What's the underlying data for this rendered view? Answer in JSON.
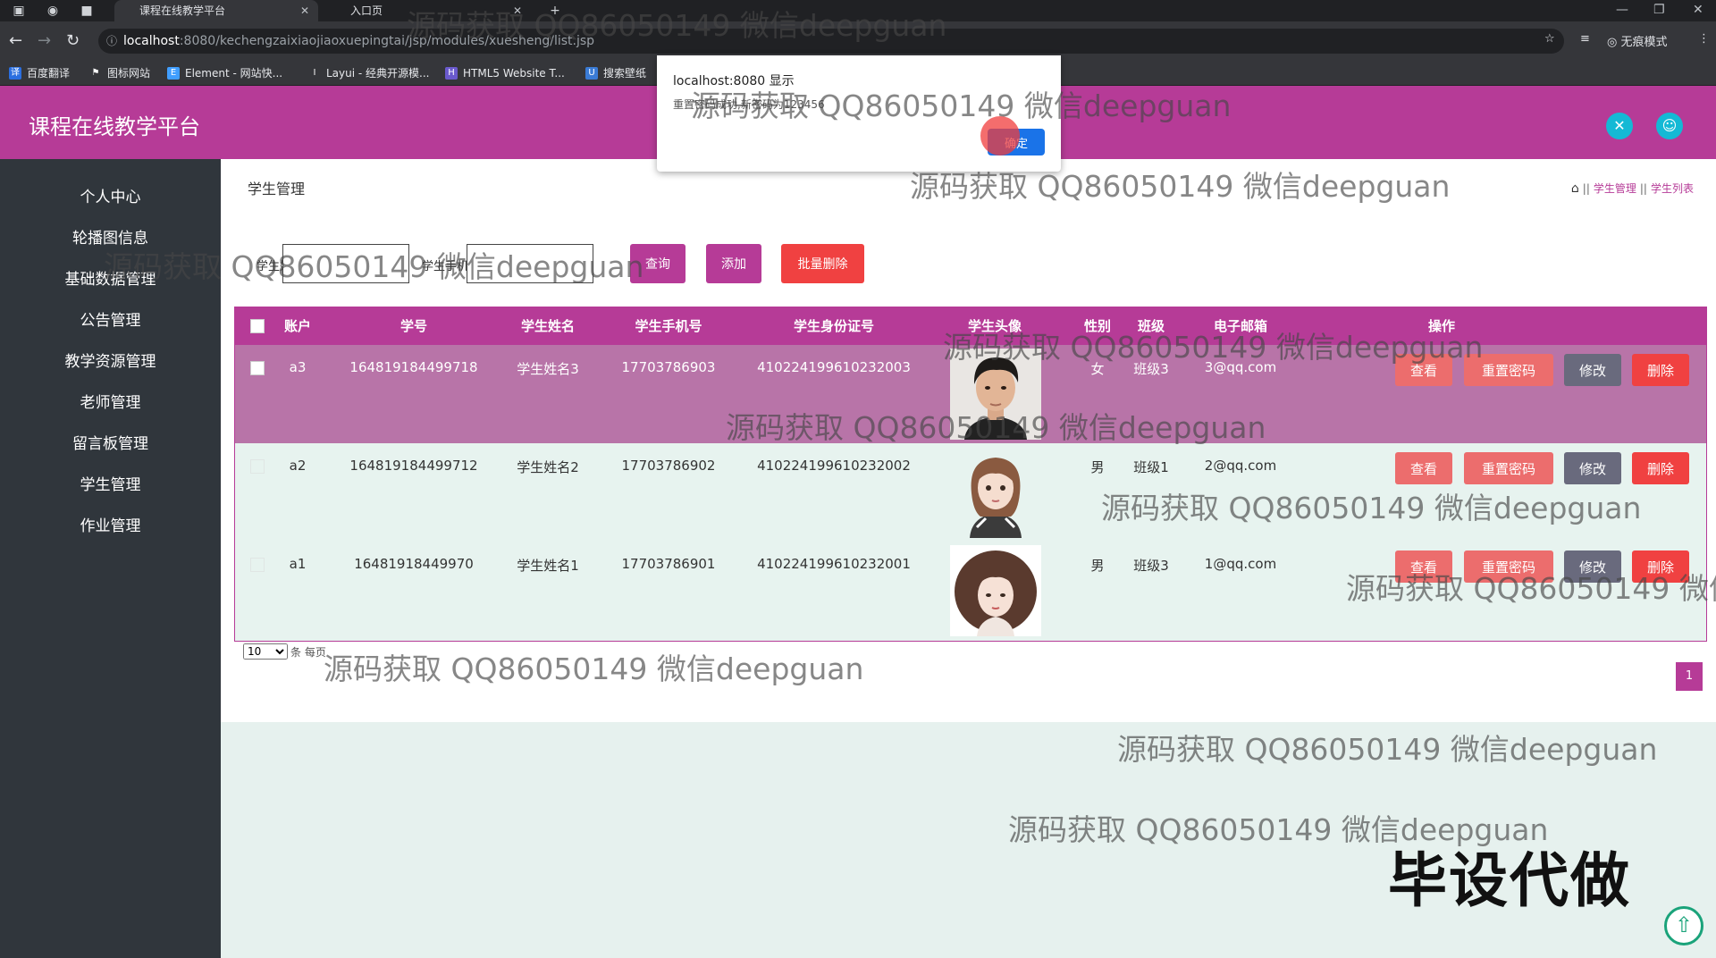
{
  "browser": {
    "tabs": [
      {
        "label": "课程在线教学平台",
        "active": true
      },
      {
        "label": "入口页",
        "active": false
      }
    ],
    "url_host": "localhost",
    "url_path": ":8080/kechengzaixiaojiaoxuepingtai/jsp/modules/xuesheng/list.jsp",
    "profile_label": "无痕模式",
    "bookmarks": [
      "百度翻译",
      "图标网站",
      "Element - 网站快...",
      "Layui - 经典开源模...",
      "HTML5 Website T...",
      "搜索壁纸"
    ]
  },
  "app": {
    "brand": "课程在线教学平台",
    "accent_color": "#b63b97",
    "sidebar_bg": "#30363c",
    "sidebar": [
      "个人中心",
      "轮播图信息",
      "基础数据管理",
      "公告管理",
      "教学资源管理",
      "老师管理",
      "留言板管理",
      "学生管理",
      "作业管理"
    ]
  },
  "page": {
    "title": "学生管理",
    "breadcrumb": [
      "学生管理",
      "学生列表"
    ]
  },
  "search": {
    "label1": "学生姓名",
    "label2": "学生手机号",
    "query_button": "查询",
    "add_button": "添加",
    "batch_delete_button": "批量删除"
  },
  "table": {
    "headers": [
      "账户",
      "学号",
      "学生姓名",
      "学生手机号",
      "学生身份证号",
      "学生头像",
      "性别",
      "班级",
      "电子邮箱",
      "操作"
    ],
    "rows": [
      {
        "account": "a3",
        "number": "164819184499718",
        "name": "学生姓名3",
        "phone": "17703786903",
        "idcard": "410224199610232003",
        "gender": "女",
        "class": "班级3",
        "email": "3@qq.com",
        "selected": true
      },
      {
        "account": "a2",
        "number": "164819184499712",
        "name": "学生姓名2",
        "phone": "17703786902",
        "idcard": "410224199610232002",
        "gender": "男",
        "class": "班级1",
        "email": "2@qq.com",
        "selected": false
      },
      {
        "account": "a1",
        "number": "16481918449970",
        "name": "学生姓名1",
        "phone": "17703786901",
        "idcard": "410224199610232001",
        "gender": "男",
        "class": "班级3",
        "email": "1@qq.com",
        "selected": false
      }
    ],
    "actions": {
      "view": "查看",
      "reset": "重置密码",
      "edit": "修改",
      "delete": "删除"
    }
  },
  "pager": {
    "page_size": "10",
    "page_size_label": "条 每页",
    "current_page": "1"
  },
  "dialog": {
    "title": "localhost:8080 显示",
    "message": "重置密码成功,新密码为123456",
    "ok": "确定"
  },
  "overlay": {
    "watermark": "源码获取 QQ86050149 微信deepguan",
    "stamp": "毕设代做"
  }
}
